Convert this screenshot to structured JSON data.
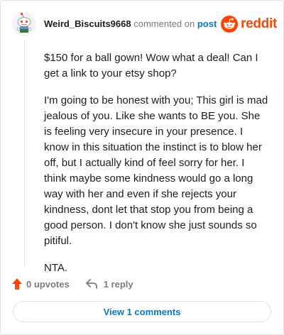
{
  "comment": {
    "author": "Weird_Biscuits9668",
    "commented_on": "commented on",
    "post_link": "post",
    "paragraphs": [
      "$150 for a ball gown! Wow what a deal! Can I get a link to your etsy shop?",
      "I'm going to be honest with you; This girl is mad jealous of you. Like she wants to BE you. She is feeling very insecure in your presence. I know in this situation the instinct is to blow her off, but I actually kind of feel sorry for her. I think maybe some kindness would go a long way with her and even if she rejects your kindness, dont let that stop you from being a good person. I don't know she just sounds so pitiful.",
      "NTA."
    ],
    "upvotes": "0 upvotes",
    "replies": "1 reply",
    "view_comments": "View 1 comments"
  },
  "brand": {
    "name": "reddit",
    "color": "#ff4500"
  },
  "colors": {
    "link": "#0079d3",
    "muted": "#787c7e",
    "upvote": "#ff4500"
  },
  "icons": {
    "avatar": "snoo-avatar-icon",
    "logo": "reddit-logo-icon",
    "upvote": "upvote-arrow-icon",
    "reply": "reply-arrow-icon"
  }
}
